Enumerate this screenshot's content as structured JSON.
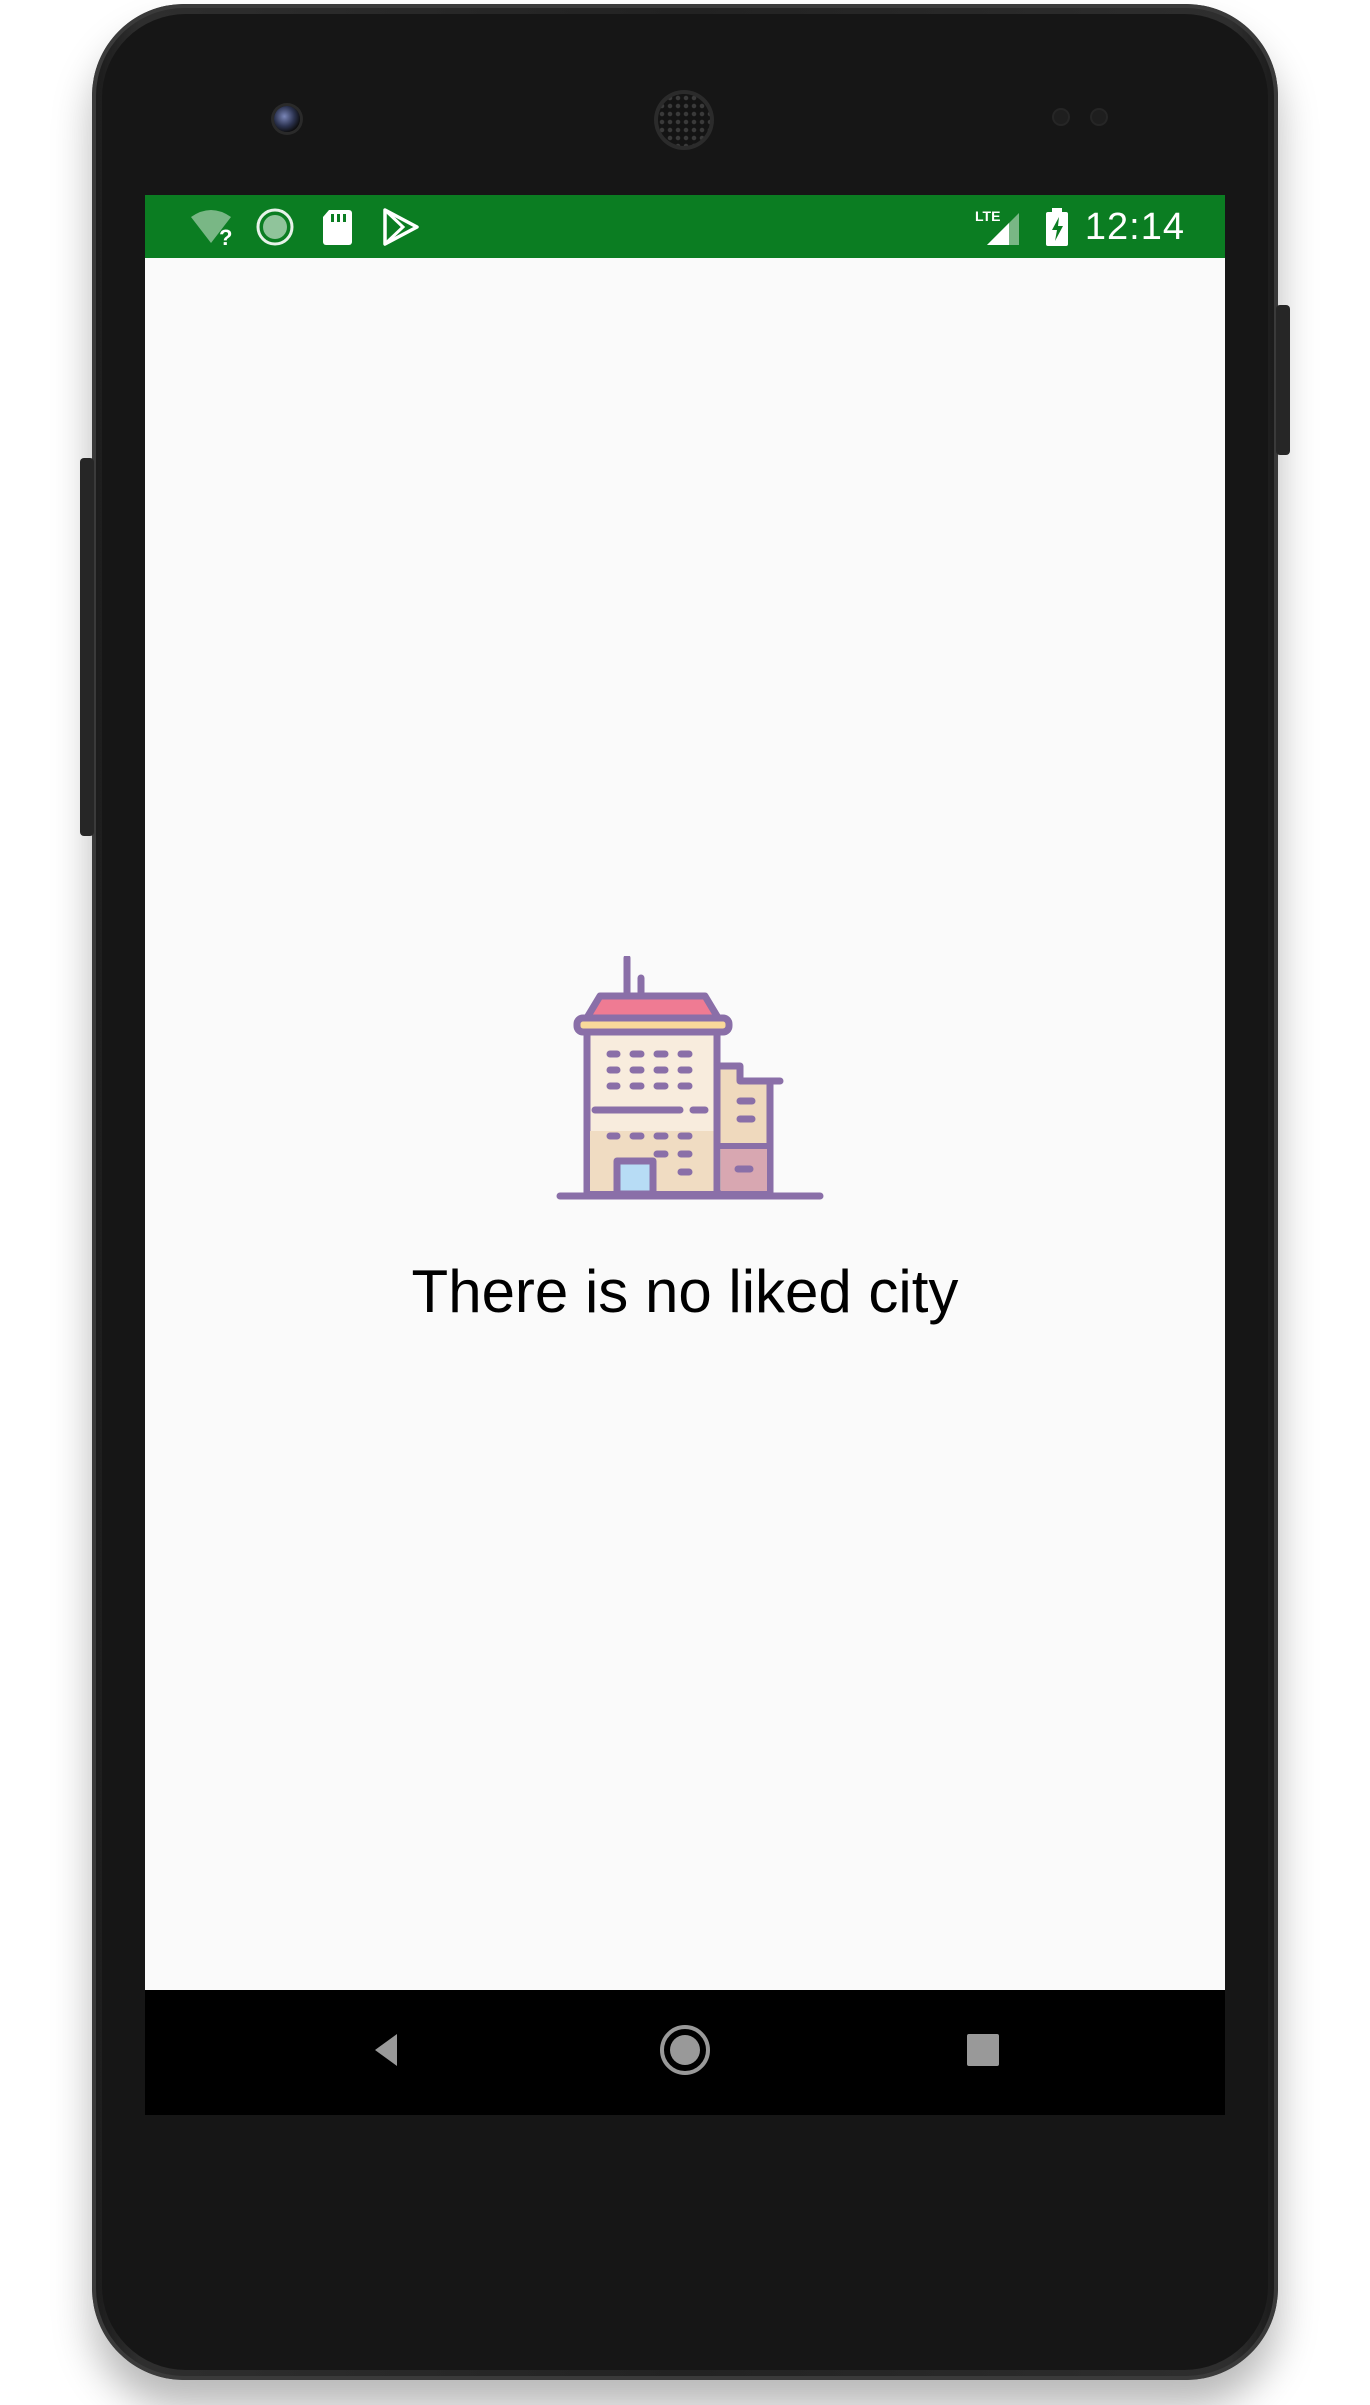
{
  "status_bar": {
    "time": "12:14",
    "network_label": "LTE",
    "icons": [
      "wifi-unknown-icon",
      "sync-progress-icon",
      "sd-card-icon",
      "play-store-icon",
      "lte-signal-icon",
      "battery-charging-icon"
    ],
    "background_color": "#0b7d22"
  },
  "main": {
    "empty_state": {
      "illustration": "building-icon",
      "message": "There is no liked city"
    },
    "background_color": "#fafafa"
  },
  "nav_bar": {
    "buttons": [
      "back-icon",
      "home-icon",
      "recents-icon"
    ]
  },
  "colors": {
    "building_outline": "#8a6fa8",
    "building_roof": "#ef7b93",
    "building_wall": "#f5e3cf",
    "building_door": "#b7dcf5"
  }
}
